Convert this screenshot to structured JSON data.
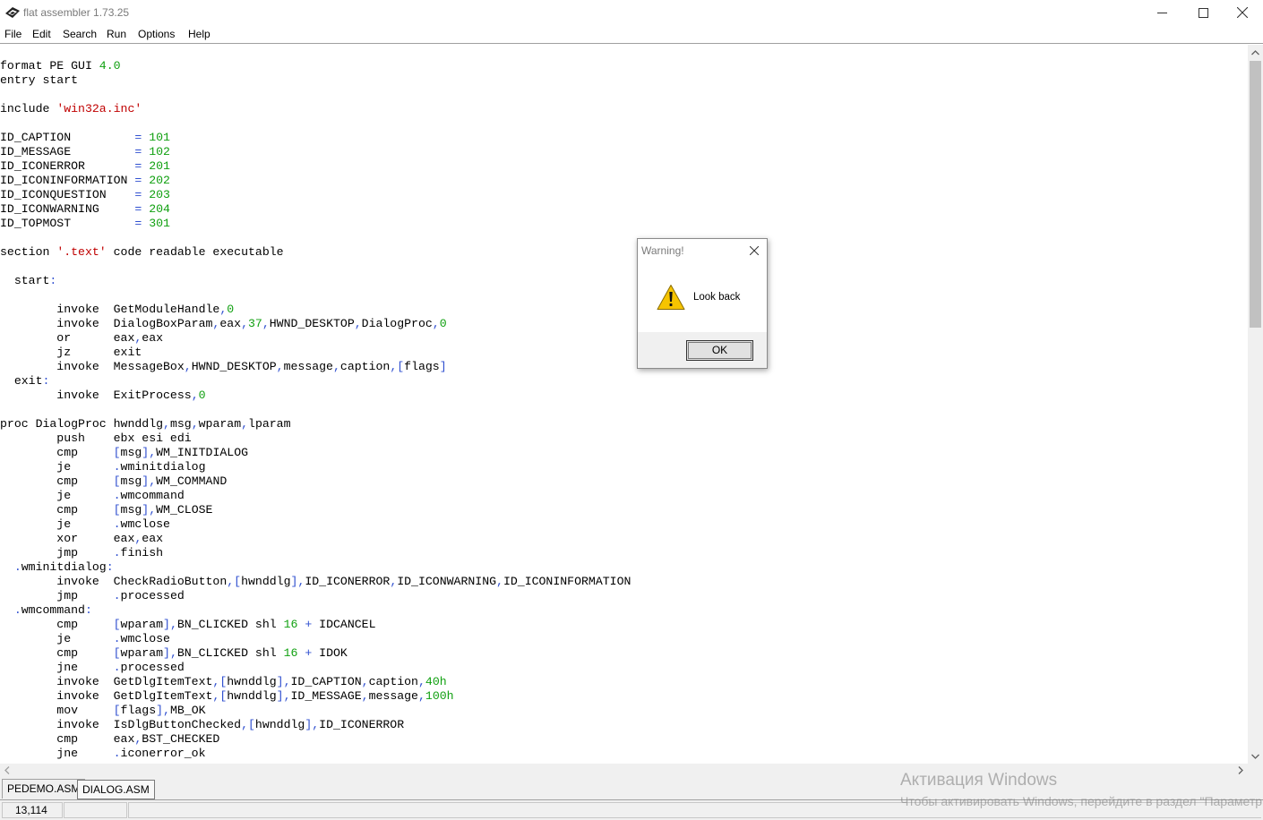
{
  "window": {
    "title": "flat assembler 1.73.25",
    "icon": "fasm-app-icon",
    "controls": [
      "minimize-icon",
      "maximize-icon",
      "close-icon"
    ]
  },
  "menu": [
    "File",
    "Edit",
    "Search",
    "Run",
    "Options",
    "Help"
  ],
  "editor": {
    "lines": [
      [
        [
          "t",
          "format PE GUI "
        ],
        [
          "n",
          "4.0"
        ]
      ],
      [
        [
          "t",
          "entry start"
        ]
      ],
      [],
      [
        [
          "t",
          "include "
        ],
        [
          "s",
          "'win32a.inc'"
        ]
      ],
      [],
      [
        [
          "t",
          "ID_CAPTION         "
        ],
        [
          "y",
          "="
        ],
        [
          "t",
          " "
        ],
        [
          "n",
          "101"
        ]
      ],
      [
        [
          "t",
          "ID_MESSAGE         "
        ],
        [
          "y",
          "="
        ],
        [
          "t",
          " "
        ],
        [
          "n",
          "102"
        ]
      ],
      [
        [
          "t",
          "ID_ICONERROR       "
        ],
        [
          "y",
          "="
        ],
        [
          "t",
          " "
        ],
        [
          "n",
          "201"
        ]
      ],
      [
        [
          "t",
          "ID_ICONINFORMATION "
        ],
        [
          "y",
          "="
        ],
        [
          "t",
          " "
        ],
        [
          "n",
          "202"
        ]
      ],
      [
        [
          "t",
          "ID_ICONQUESTION    "
        ],
        [
          "y",
          "="
        ],
        [
          "t",
          " "
        ],
        [
          "n",
          "203"
        ]
      ],
      [
        [
          "t",
          "ID_ICONWARNING     "
        ],
        [
          "y",
          "="
        ],
        [
          "t",
          " "
        ],
        [
          "n",
          "204"
        ]
      ],
      [
        [
          "t",
          "ID_TOPMOST         "
        ],
        [
          "y",
          "="
        ],
        [
          "t",
          " "
        ],
        [
          "n",
          "301"
        ]
      ],
      [],
      [
        [
          "t",
          "section "
        ],
        [
          "s",
          "'.text'"
        ],
        [
          "t",
          " code readable executable"
        ]
      ],
      [],
      [
        [
          "t",
          "  start"
        ],
        [
          "y",
          ":"
        ]
      ],
      [],
      [
        [
          "t",
          "        invoke  GetModuleHandle"
        ],
        [
          "y",
          ","
        ],
        [
          "n",
          "0"
        ]
      ],
      [
        [
          "t",
          "        invoke  DialogBoxParam"
        ],
        [
          "y",
          ","
        ],
        [
          "t",
          "eax"
        ],
        [
          "y",
          ","
        ],
        [
          "n",
          "37"
        ],
        [
          "y",
          ","
        ],
        [
          "t",
          "HWND_DESKTOP"
        ],
        [
          "y",
          ","
        ],
        [
          "t",
          "DialogProc"
        ],
        [
          "y",
          ","
        ],
        [
          "n",
          "0"
        ]
      ],
      [
        [
          "t",
          "        or      eax"
        ],
        [
          "y",
          ","
        ],
        [
          "t",
          "eax"
        ]
      ],
      [
        [
          "t",
          "        jz      exit"
        ]
      ],
      [
        [
          "t",
          "        invoke  MessageBox"
        ],
        [
          "y",
          ","
        ],
        [
          "t",
          "HWND_DESKTOP"
        ],
        [
          "y",
          ","
        ],
        [
          "t",
          "message"
        ],
        [
          "y",
          ","
        ],
        [
          "t",
          "caption"
        ],
        [
          "y",
          ","
        ],
        [
          "y",
          "["
        ],
        [
          "t",
          "flags"
        ],
        [
          "y",
          "]"
        ]
      ],
      [
        [
          "t",
          "  exit"
        ],
        [
          "y",
          ":"
        ]
      ],
      [
        [
          "t",
          "        invoke  ExitProcess"
        ],
        [
          "y",
          ","
        ],
        [
          "n",
          "0"
        ]
      ],
      [],
      [
        [
          "t",
          "proc DialogProc hwnddlg"
        ],
        [
          "y",
          ","
        ],
        [
          "t",
          "msg"
        ],
        [
          "y",
          ","
        ],
        [
          "t",
          "wparam"
        ],
        [
          "y",
          ","
        ],
        [
          "t",
          "lparam"
        ]
      ],
      [
        [
          "t",
          "        push    ebx esi edi"
        ]
      ],
      [
        [
          "t",
          "        cmp     "
        ],
        [
          "y",
          "["
        ],
        [
          "t",
          "msg"
        ],
        [
          "y",
          "]"
        ],
        [
          "y",
          ","
        ],
        [
          "t",
          "WM_INITDIALOG"
        ]
      ],
      [
        [
          "t",
          "        je      "
        ],
        [
          "y",
          "."
        ],
        [
          "t",
          "wminitdialog"
        ]
      ],
      [
        [
          "t",
          "        cmp     "
        ],
        [
          "y",
          "["
        ],
        [
          "t",
          "msg"
        ],
        [
          "y",
          "]"
        ],
        [
          "y",
          ","
        ],
        [
          "t",
          "WM_COMMAND"
        ]
      ],
      [
        [
          "t",
          "        je      "
        ],
        [
          "y",
          "."
        ],
        [
          "t",
          "wmcommand"
        ]
      ],
      [
        [
          "t",
          "        cmp     "
        ],
        [
          "y",
          "["
        ],
        [
          "t",
          "msg"
        ],
        [
          "y",
          "]"
        ],
        [
          "y",
          ","
        ],
        [
          "t",
          "WM_CLOSE"
        ]
      ],
      [
        [
          "t",
          "        je      "
        ],
        [
          "y",
          "."
        ],
        [
          "t",
          "wmclose"
        ]
      ],
      [
        [
          "t",
          "        xor     eax"
        ],
        [
          "y",
          ","
        ],
        [
          "t",
          "eax"
        ]
      ],
      [
        [
          "t",
          "        jmp     "
        ],
        [
          "y",
          "."
        ],
        [
          "t",
          "finish"
        ]
      ],
      [
        [
          "t",
          "  "
        ],
        [
          "y",
          "."
        ],
        [
          "t",
          "wminitdialog"
        ],
        [
          "y",
          ":"
        ]
      ],
      [
        [
          "t",
          "        invoke  CheckRadioButton"
        ],
        [
          "y",
          ","
        ],
        [
          "y",
          "["
        ],
        [
          "t",
          "hwnddlg"
        ],
        [
          "y",
          "]"
        ],
        [
          "y",
          ","
        ],
        [
          "t",
          "ID_ICONERROR"
        ],
        [
          "y",
          ","
        ],
        [
          "t",
          "ID_ICONWARNING"
        ],
        [
          "y",
          ","
        ],
        [
          "t",
          "ID_ICONINFORMATION"
        ]
      ],
      [
        [
          "t",
          "        jmp     "
        ],
        [
          "y",
          "."
        ],
        [
          "t",
          "processed"
        ]
      ],
      [
        [
          "t",
          "  "
        ],
        [
          "y",
          "."
        ],
        [
          "t",
          "wmcommand"
        ],
        [
          "y",
          ":"
        ]
      ],
      [
        [
          "t",
          "        cmp     "
        ],
        [
          "y",
          "["
        ],
        [
          "t",
          "wparam"
        ],
        [
          "y",
          "]"
        ],
        [
          "y",
          ","
        ],
        [
          "t",
          "BN_CLICKED shl "
        ],
        [
          "n",
          "16"
        ],
        [
          "t",
          " "
        ],
        [
          "y",
          "+"
        ],
        [
          "t",
          " IDCANCEL"
        ]
      ],
      [
        [
          "t",
          "        je      "
        ],
        [
          "y",
          "."
        ],
        [
          "t",
          "wmclose"
        ]
      ],
      [
        [
          "t",
          "        cmp     "
        ],
        [
          "y",
          "["
        ],
        [
          "t",
          "wparam"
        ],
        [
          "y",
          "]"
        ],
        [
          "y",
          ","
        ],
        [
          "t",
          "BN_CLICKED shl "
        ],
        [
          "n",
          "16"
        ],
        [
          "t",
          " "
        ],
        [
          "y",
          "+"
        ],
        [
          "t",
          " IDOK"
        ]
      ],
      [
        [
          "t",
          "        jne     "
        ],
        [
          "y",
          "."
        ],
        [
          "t",
          "processed"
        ]
      ],
      [
        [
          "t",
          "        invoke  GetDlgItemText"
        ],
        [
          "y",
          ","
        ],
        [
          "y",
          "["
        ],
        [
          "t",
          "hwnddlg"
        ],
        [
          "y",
          "]"
        ],
        [
          "y",
          ","
        ],
        [
          "t",
          "ID_CAPTION"
        ],
        [
          "y",
          ","
        ],
        [
          "t",
          "caption"
        ],
        [
          "y",
          ","
        ],
        [
          "n",
          "40h"
        ]
      ],
      [
        [
          "t",
          "        invoke  GetDlgItemText"
        ],
        [
          "y",
          ","
        ],
        [
          "y",
          "["
        ],
        [
          "t",
          "hwnddlg"
        ],
        [
          "y",
          "]"
        ],
        [
          "y",
          ","
        ],
        [
          "t",
          "ID_MESSAGE"
        ],
        [
          "y",
          ","
        ],
        [
          "t",
          "message"
        ],
        [
          "y",
          ","
        ],
        [
          "n",
          "100h"
        ]
      ],
      [
        [
          "t",
          "        mov     "
        ],
        [
          "y",
          "["
        ],
        [
          "t",
          "flags"
        ],
        [
          "y",
          "]"
        ],
        [
          "y",
          ","
        ],
        [
          "t",
          "MB_OK"
        ]
      ],
      [
        [
          "t",
          "        invoke  IsDlgButtonChecked"
        ],
        [
          "y",
          ","
        ],
        [
          "y",
          "["
        ],
        [
          "t",
          "hwnddlg"
        ],
        [
          "y",
          "]"
        ],
        [
          "y",
          ","
        ],
        [
          "t",
          "ID_ICONERROR"
        ]
      ],
      [
        [
          "t",
          "        cmp     eax"
        ],
        [
          "y",
          ","
        ],
        [
          "t",
          "BST_CHECKED"
        ]
      ],
      [
        [
          "t",
          "        jne     "
        ],
        [
          "y",
          "."
        ],
        [
          "t",
          "iconerror_ok"
        ]
      ]
    ]
  },
  "tabs": [
    {
      "label": "PEDEMO.ASM",
      "active": true
    },
    {
      "label": "DIALOG.ASM",
      "active": false
    }
  ],
  "status": {
    "position": "13,114",
    "mode": "",
    "modified": ""
  },
  "watermark": {
    "title": "Активация Windows",
    "subtitle": "Чтобы активировать Windows, перейдите в раздел \"Параметры\""
  },
  "dialog": {
    "title": "Warning!",
    "message": "Look back",
    "icon": "warning-icon",
    "ok_label": "OK"
  },
  "colors": {
    "number": "#10a010",
    "string": "#c00000",
    "symbol": "#3050d0",
    "chrome": "#f0f0f0"
  }
}
